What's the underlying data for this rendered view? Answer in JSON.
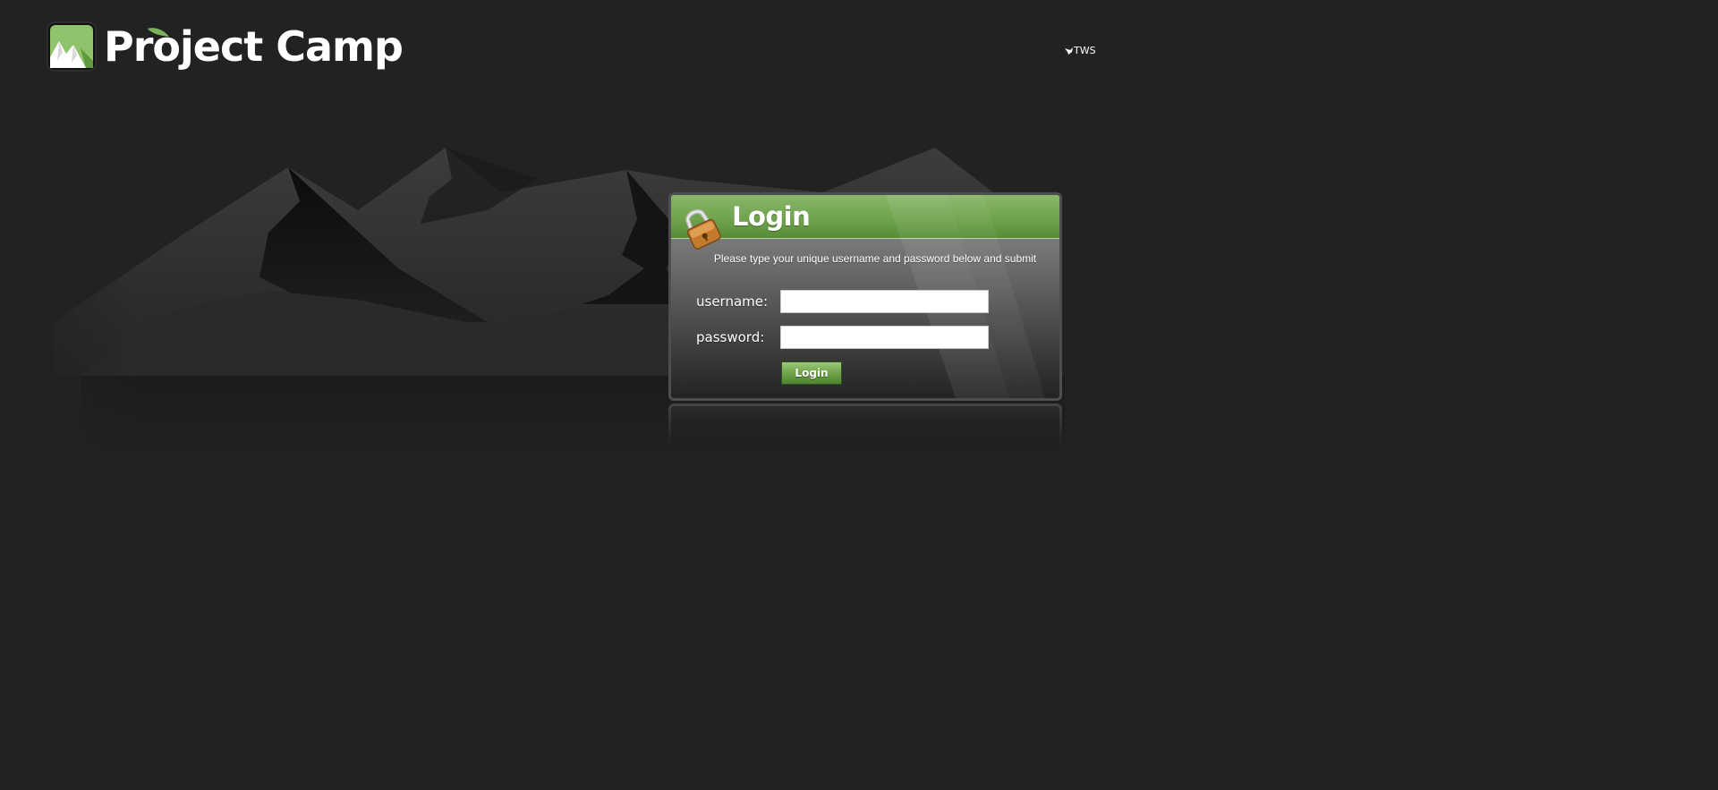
{
  "brand": {
    "name": "Project Camp",
    "logo_icon": "mountain-logo-icon",
    "accent_color": "#7cb35a"
  },
  "tws": {
    "text": "TWS",
    "icon": "tws-bird-icon"
  },
  "login": {
    "title": "Login",
    "lock_icon": "padlock-icon",
    "instructions": "Please type your unique username and password below and submit",
    "username_label": "username:",
    "password_label": "password:",
    "username_value": "",
    "password_value": "",
    "submit_label": "Login"
  }
}
